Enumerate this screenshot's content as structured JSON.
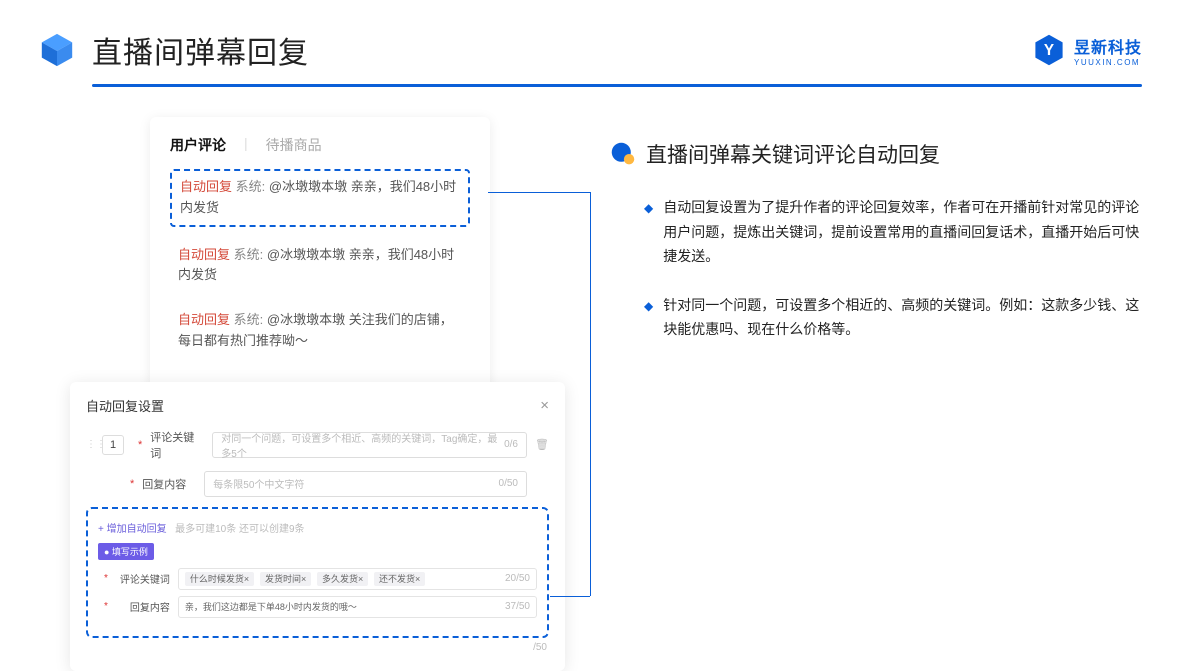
{
  "header": {
    "title": "直播间弹幕回复",
    "brand_name": "昱新科技",
    "brand_sub": "YUUXIN.COM"
  },
  "comments_card": {
    "tab_active": "用户评论",
    "tab_inactive": "待播商品",
    "row1_tag": "自动回复",
    "row1_sys": "系统:",
    "row1_text": "@冰墩墩本墩 亲亲，我们48小时内发货",
    "row2_tag": "自动回复",
    "row2_sys": "系统:",
    "row2_text": "@冰墩墩本墩 亲亲，我们48小时内发货",
    "row3_tag": "自动回复",
    "row3_sys": "系统:",
    "row3_text": "@冰墩墩本墩 关注我们的店铺，每日都有热门推荐呦～"
  },
  "settings_card": {
    "title": "自动回复设置",
    "order": "1",
    "kw_label": "评论关键词",
    "kw_placeholder": "对同一个问题，可设置多个相近、高频的关键词，Tag确定，最多5个",
    "kw_counter": "0/6",
    "content_label": "回复内容",
    "content_placeholder": "每条限50个中文字符",
    "content_counter": "0/50",
    "add_link": "+ 增加自动回复",
    "add_hint": "最多可建10条 还可以创建9条",
    "badge": "● 填写示例",
    "eg_kw_label": "评论关键词",
    "eg_kw_chip1": "什么时候发货×",
    "eg_kw_chip2": "发货时间×",
    "eg_kw_chip3": "多久发货×",
    "eg_kw_chip4": "还不发货×",
    "eg_kw_counter": "20/50",
    "eg_ct_label": "回复内容",
    "eg_ct_text": "亲，我们这边都是下单48小时内发货的哦～",
    "eg_ct_counter": "37/50",
    "right_counter": "/50"
  },
  "right": {
    "section_title": "直播间弹幕关键词评论自动回复",
    "b1": "自动回复设置为了提升作者的评论回复效率，作者可在开播前针对常见的评论用户问题，提炼出关键词，提前设置常用的直播间回复话术，直播开始后可快捷发送。",
    "b2": "针对同一个问题，可设置多个相近的、高频的关键词。例如：这款多少钱、这块能优惠吗、现在什么价格等。"
  }
}
